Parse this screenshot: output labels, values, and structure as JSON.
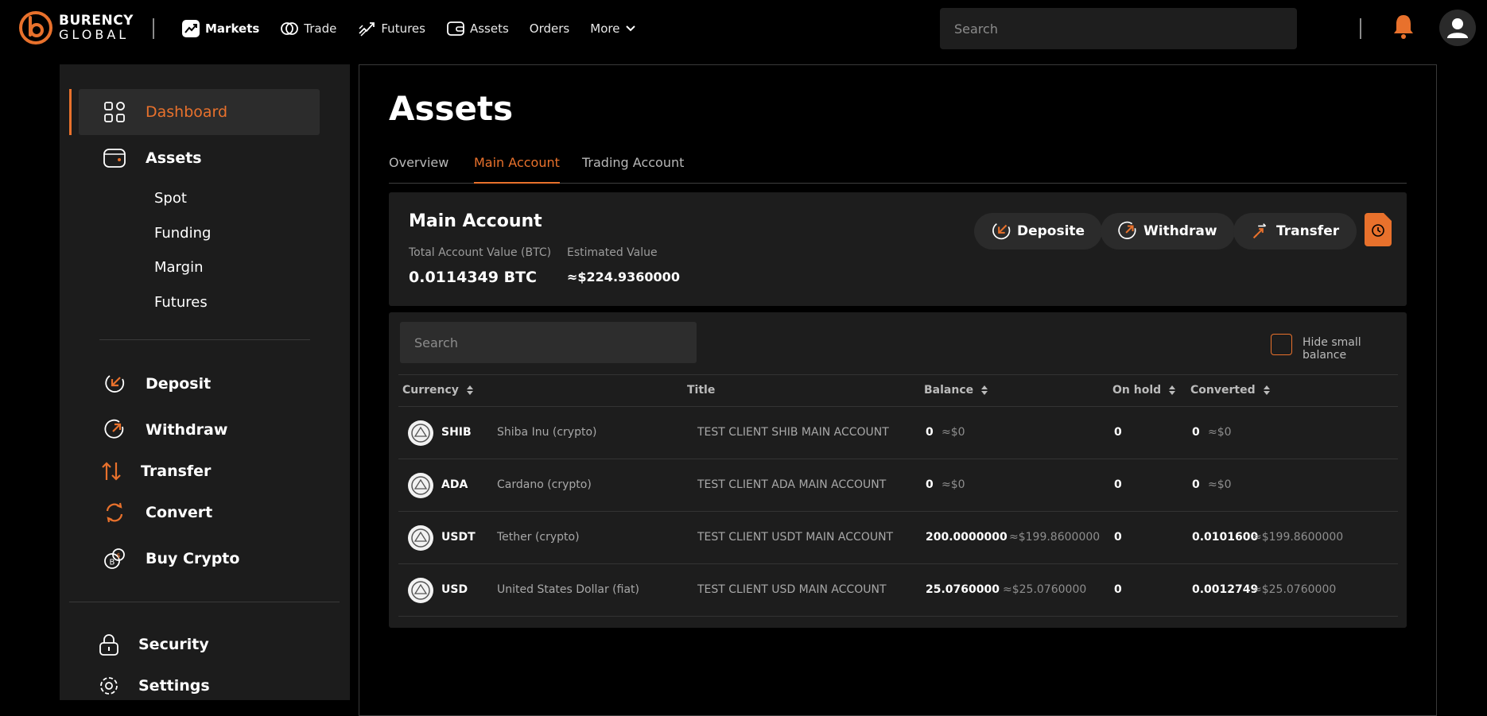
{
  "brand": {
    "line1": "BURENCY",
    "line2": "GLOBAL",
    "accent": "#E8712C"
  },
  "nav": {
    "items": [
      {
        "label": "Markets",
        "icon": "markets-icon"
      },
      {
        "label": "Trade",
        "icon": "trade-icon"
      },
      {
        "label": "Futures",
        "icon": "futures-icon"
      },
      {
        "label": "Assets",
        "icon": "assets-icon"
      },
      {
        "label": "Orders"
      },
      {
        "label": "More",
        "icon": "chevron-down-icon"
      }
    ],
    "search_placeholder": "Search"
  },
  "sidebar": {
    "dashboard": "Dashboard",
    "assets": "Assets",
    "sub": [
      "Spot",
      "Funding",
      "Margin",
      "Futures"
    ],
    "deposit": "Deposit",
    "withdraw": "Withdraw",
    "transfer": "Transfer",
    "convert": "Convert",
    "buy_crypto": "Buy Crypto",
    "security": "Security",
    "settings": "Settings"
  },
  "main": {
    "title": "Assets",
    "tabs": [
      "Overview",
      "Main Account",
      "Trading Account"
    ],
    "active_tab": "Main Account",
    "account": {
      "title": "Main Account",
      "total_label": "Total Account Value (BTC)",
      "total_value": "0.0114349 BTC",
      "est_label": "Estimated Value",
      "est_value": "≈$224.9360000"
    },
    "actions": {
      "deposit": "Deposite",
      "withdraw": "Withdraw",
      "transfer": "Transfer"
    },
    "table": {
      "search_placeholder": "Search",
      "hide_small_label": "Hide small balance",
      "hide_small_checked": false,
      "headers": {
        "currency": "Currency",
        "title": "Title",
        "balance": "Balance",
        "on_hold": "On hold",
        "converted": "Converted"
      },
      "rows": [
        {
          "symbol": "SHIB",
          "name": "Shiba Inu (crypto)",
          "title": "TEST CLIENT SHIB MAIN ACCOUNT",
          "balance": "0",
          "balance_approx": "≈$0",
          "on_hold": "0",
          "converted": "0",
          "converted_approx": "≈$0"
        },
        {
          "symbol": "ADA",
          "name": "Cardano (crypto)",
          "title": "TEST CLIENT ADA MAIN ACCOUNT",
          "balance": "0",
          "balance_approx": "≈$0",
          "on_hold": "0",
          "converted": "0",
          "converted_approx": "≈$0"
        },
        {
          "symbol": "USDT",
          "name": "Tether (crypto)",
          "title": "TEST CLIENT USDT MAIN ACCOUNT",
          "balance": "200.0000000",
          "balance_approx": "≈$199.8600000",
          "on_hold": "0",
          "converted": "0.0101600",
          "converted_approx": "≈$199.8600000"
        },
        {
          "symbol": "USD",
          "name": "United States Dollar (fiat)",
          "title": "TEST CLIENT USD MAIN ACCOUNT",
          "balance": "25.0760000",
          "balance_approx": "≈$25.0760000",
          "on_hold": "0",
          "converted": "0.0012749",
          "converted_approx": "≈$25.0760000"
        }
      ]
    }
  }
}
